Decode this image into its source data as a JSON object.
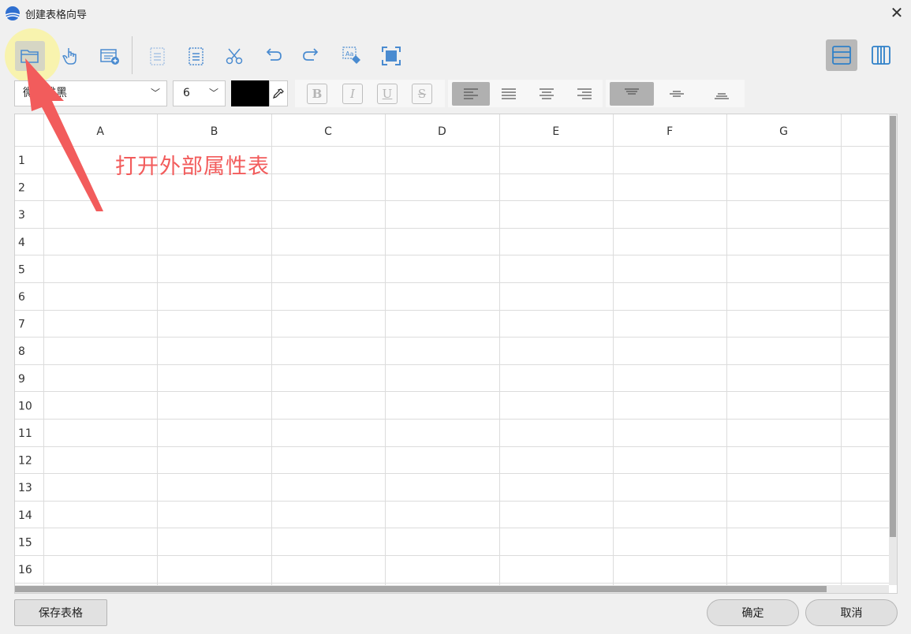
{
  "window": {
    "title": "创建表格向导",
    "close": "✕"
  },
  "format": {
    "font_name": "微软雅黑",
    "font_size": "6",
    "text_color": "#000000",
    "bold": "B",
    "italic": "I",
    "underline": "U",
    "strike": "S"
  },
  "grid": {
    "columns": [
      "A",
      "B",
      "C",
      "D",
      "E",
      "F",
      "G"
    ],
    "rows": [
      "1",
      "2",
      "3",
      "4",
      "5",
      "6",
      "7",
      "8",
      "9",
      "10",
      "11",
      "12",
      "13",
      "14",
      "15",
      "16"
    ]
  },
  "annotation": {
    "text": "打开外部属性表",
    "color": "#f25c5c"
  },
  "buttons": {
    "save": "保存表格",
    "ok": "确定",
    "cancel": "取消"
  },
  "colors": {
    "accent": "#2f80c8",
    "annotation": "#f25c5c"
  }
}
